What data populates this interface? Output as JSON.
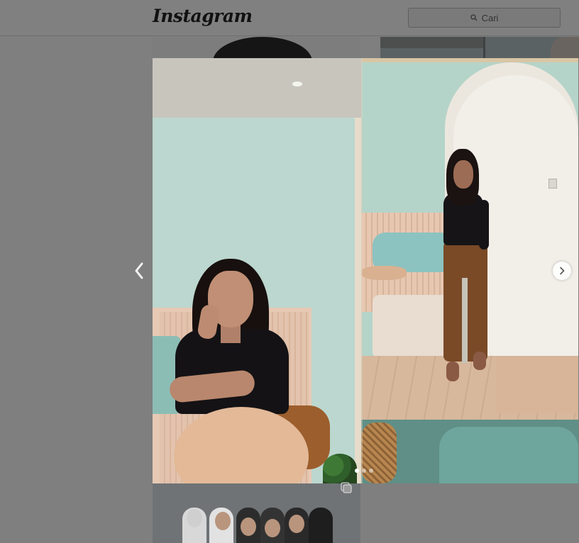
{
  "header": {
    "logo_text": "Instagram",
    "search": {
      "placeholder": "Cari",
      "icon": "search-icon"
    }
  },
  "carousel": {
    "current_slide": 1,
    "total_slides": 3,
    "prev_icon": "chevron-left-icon",
    "next_icon": "chevron-right-icon"
  },
  "colors": {
    "overlay": "#7f7f7f",
    "active_dot": "#ffffff",
    "inactive_dot": "#bfbfbf"
  }
}
